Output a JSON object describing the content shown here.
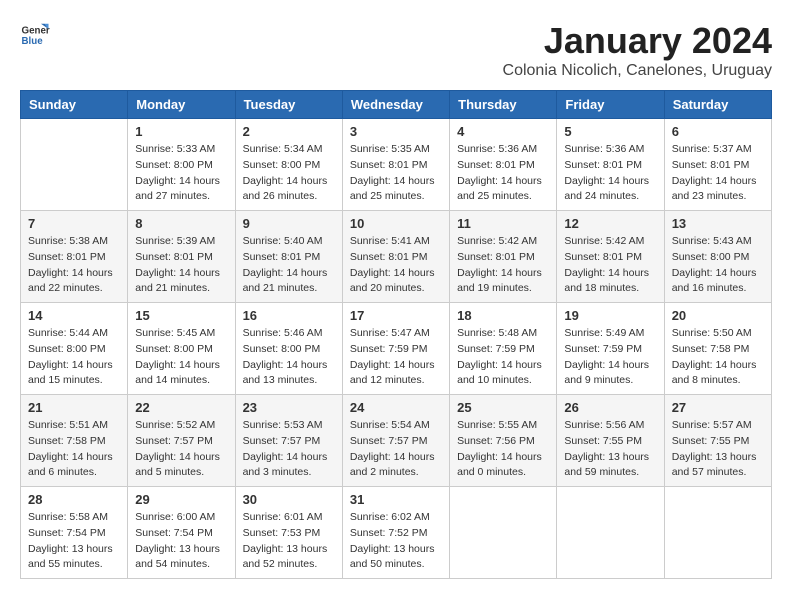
{
  "logo": {
    "general": "General",
    "blue": "Blue"
  },
  "title": "January 2024",
  "subtitle": "Colonia Nicolich, Canelones, Uruguay",
  "days_header": [
    "Sunday",
    "Monday",
    "Tuesday",
    "Wednesday",
    "Thursday",
    "Friday",
    "Saturday"
  ],
  "weeks": [
    [
      {
        "day": "",
        "info": ""
      },
      {
        "day": "1",
        "info": "Sunrise: 5:33 AM\nSunset: 8:00 PM\nDaylight: 14 hours\nand 27 minutes."
      },
      {
        "day": "2",
        "info": "Sunrise: 5:34 AM\nSunset: 8:00 PM\nDaylight: 14 hours\nand 26 minutes."
      },
      {
        "day": "3",
        "info": "Sunrise: 5:35 AM\nSunset: 8:01 PM\nDaylight: 14 hours\nand 25 minutes."
      },
      {
        "day": "4",
        "info": "Sunrise: 5:36 AM\nSunset: 8:01 PM\nDaylight: 14 hours\nand 25 minutes."
      },
      {
        "day": "5",
        "info": "Sunrise: 5:36 AM\nSunset: 8:01 PM\nDaylight: 14 hours\nand 24 minutes."
      },
      {
        "day": "6",
        "info": "Sunrise: 5:37 AM\nSunset: 8:01 PM\nDaylight: 14 hours\nand 23 minutes."
      }
    ],
    [
      {
        "day": "7",
        "info": "Sunrise: 5:38 AM\nSunset: 8:01 PM\nDaylight: 14 hours\nand 22 minutes."
      },
      {
        "day": "8",
        "info": "Sunrise: 5:39 AM\nSunset: 8:01 PM\nDaylight: 14 hours\nand 21 minutes."
      },
      {
        "day": "9",
        "info": "Sunrise: 5:40 AM\nSunset: 8:01 PM\nDaylight: 14 hours\nand 21 minutes."
      },
      {
        "day": "10",
        "info": "Sunrise: 5:41 AM\nSunset: 8:01 PM\nDaylight: 14 hours\nand 20 minutes."
      },
      {
        "day": "11",
        "info": "Sunrise: 5:42 AM\nSunset: 8:01 PM\nDaylight: 14 hours\nand 19 minutes."
      },
      {
        "day": "12",
        "info": "Sunrise: 5:42 AM\nSunset: 8:01 PM\nDaylight: 14 hours\nand 18 minutes."
      },
      {
        "day": "13",
        "info": "Sunrise: 5:43 AM\nSunset: 8:00 PM\nDaylight: 14 hours\nand 16 minutes."
      }
    ],
    [
      {
        "day": "14",
        "info": "Sunrise: 5:44 AM\nSunset: 8:00 PM\nDaylight: 14 hours\nand 15 minutes."
      },
      {
        "day": "15",
        "info": "Sunrise: 5:45 AM\nSunset: 8:00 PM\nDaylight: 14 hours\nand 14 minutes."
      },
      {
        "day": "16",
        "info": "Sunrise: 5:46 AM\nSunset: 8:00 PM\nDaylight: 14 hours\nand 13 minutes."
      },
      {
        "day": "17",
        "info": "Sunrise: 5:47 AM\nSunset: 7:59 PM\nDaylight: 14 hours\nand 12 minutes."
      },
      {
        "day": "18",
        "info": "Sunrise: 5:48 AM\nSunset: 7:59 PM\nDaylight: 14 hours\nand 10 minutes."
      },
      {
        "day": "19",
        "info": "Sunrise: 5:49 AM\nSunset: 7:59 PM\nDaylight: 14 hours\nand 9 minutes."
      },
      {
        "day": "20",
        "info": "Sunrise: 5:50 AM\nSunset: 7:58 PM\nDaylight: 14 hours\nand 8 minutes."
      }
    ],
    [
      {
        "day": "21",
        "info": "Sunrise: 5:51 AM\nSunset: 7:58 PM\nDaylight: 14 hours\nand 6 minutes."
      },
      {
        "day": "22",
        "info": "Sunrise: 5:52 AM\nSunset: 7:57 PM\nDaylight: 14 hours\nand 5 minutes."
      },
      {
        "day": "23",
        "info": "Sunrise: 5:53 AM\nSunset: 7:57 PM\nDaylight: 14 hours\nand 3 minutes."
      },
      {
        "day": "24",
        "info": "Sunrise: 5:54 AM\nSunset: 7:57 PM\nDaylight: 14 hours\nand 2 minutes."
      },
      {
        "day": "25",
        "info": "Sunrise: 5:55 AM\nSunset: 7:56 PM\nDaylight: 14 hours\nand 0 minutes."
      },
      {
        "day": "26",
        "info": "Sunrise: 5:56 AM\nSunset: 7:55 PM\nDaylight: 13 hours\nand 59 minutes."
      },
      {
        "day": "27",
        "info": "Sunrise: 5:57 AM\nSunset: 7:55 PM\nDaylight: 13 hours\nand 57 minutes."
      }
    ],
    [
      {
        "day": "28",
        "info": "Sunrise: 5:58 AM\nSunset: 7:54 PM\nDaylight: 13 hours\nand 55 minutes."
      },
      {
        "day": "29",
        "info": "Sunrise: 6:00 AM\nSunset: 7:54 PM\nDaylight: 13 hours\nand 54 minutes."
      },
      {
        "day": "30",
        "info": "Sunrise: 6:01 AM\nSunset: 7:53 PM\nDaylight: 13 hours\nand 52 minutes."
      },
      {
        "day": "31",
        "info": "Sunrise: 6:02 AM\nSunset: 7:52 PM\nDaylight: 13 hours\nand 50 minutes."
      },
      {
        "day": "",
        "info": ""
      },
      {
        "day": "",
        "info": ""
      },
      {
        "day": "",
        "info": ""
      }
    ]
  ]
}
